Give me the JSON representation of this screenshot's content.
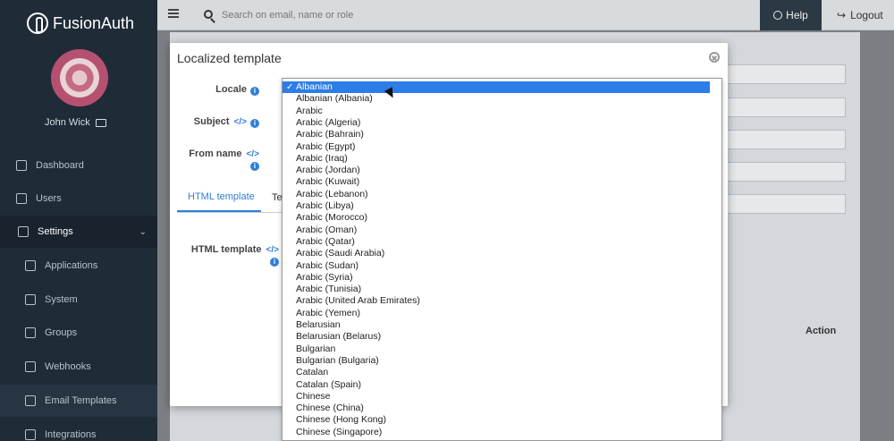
{
  "app": {
    "brand": "FusionAuth",
    "user_name": "John Wick"
  },
  "sidebar": {
    "items": [
      {
        "label": "Dashboard",
        "icon": "dashboard-icon"
      },
      {
        "label": "Users",
        "icon": "users-icon"
      },
      {
        "label": "Settings",
        "icon": "gear-icon"
      },
      {
        "label": "Applications",
        "icon": "applications-icon"
      },
      {
        "label": "System",
        "icon": "system-icon"
      },
      {
        "label": "Groups",
        "icon": "groups-icon"
      },
      {
        "label": "Webhooks",
        "icon": "webhooks-icon"
      },
      {
        "label": "Email Templates",
        "icon": "email-icon"
      },
      {
        "label": "Integrations",
        "icon": "integrations-icon"
      }
    ]
  },
  "topbar": {
    "search_placeholder": "Search on email, name or role",
    "help": "Help",
    "logout": "Logout"
  },
  "background": {
    "action_header": "Action"
  },
  "modal": {
    "title": "Localized template",
    "locale_label": "Locale",
    "subject_label": "Subject",
    "from_name_label": "From name",
    "tab_html": "HTML template",
    "tab_text_partial": "Te",
    "html_template_label": "HTML template"
  },
  "dropdown": {
    "selected": "Albanian",
    "options": [
      "Albanian",
      "Albanian (Albania)",
      "Arabic",
      "Arabic (Algeria)",
      "Arabic (Bahrain)",
      "Arabic (Egypt)",
      "Arabic (Iraq)",
      "Arabic (Jordan)",
      "Arabic (Kuwait)",
      "Arabic (Lebanon)",
      "Arabic (Libya)",
      "Arabic (Morocco)",
      "Arabic (Oman)",
      "Arabic (Qatar)",
      "Arabic (Saudi Arabia)",
      "Arabic (Sudan)",
      "Arabic (Syria)",
      "Arabic (Tunisia)",
      "Arabic (United Arab Emirates)",
      "Arabic (Yemen)",
      "Belarusian",
      "Belarusian (Belarus)",
      "Bulgarian",
      "Bulgarian (Bulgaria)",
      "Catalan",
      "Catalan (Spain)",
      "Chinese",
      "Chinese (China)",
      "Chinese (Hong Kong)",
      "Chinese (Singapore)"
    ]
  }
}
